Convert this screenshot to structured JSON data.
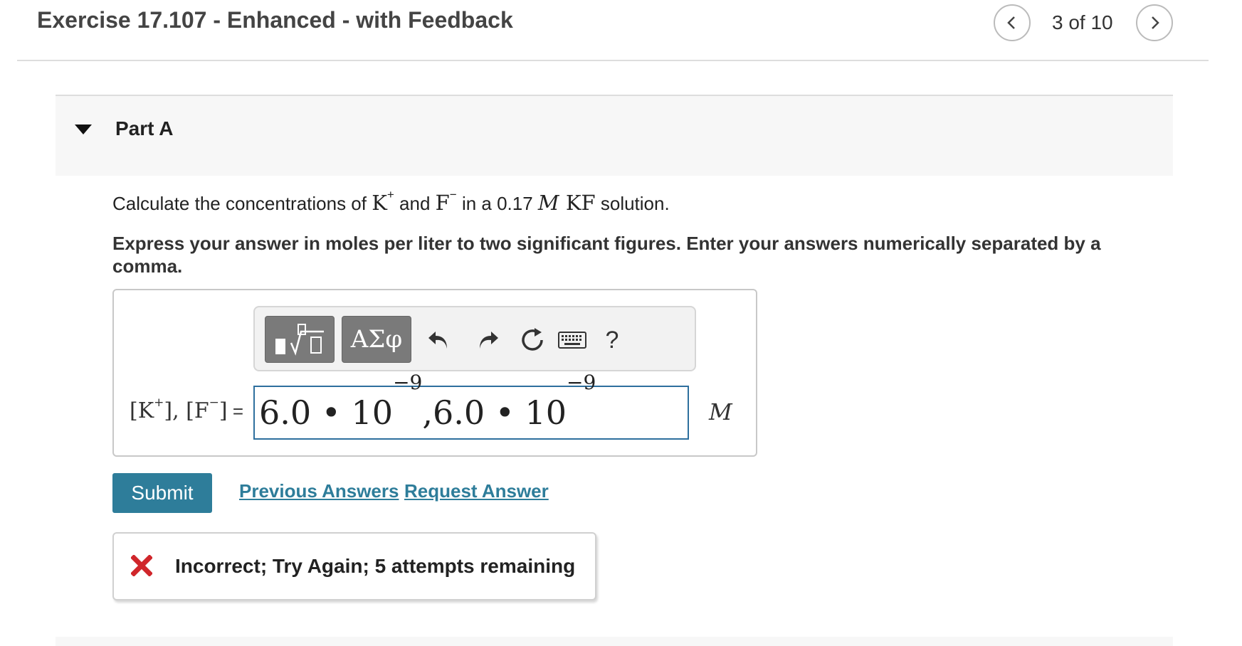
{
  "header": {
    "title": "Exercise 17.107 - Enhanced - with Feedback",
    "counter": "3 of 10"
  },
  "part": {
    "label": "Part A"
  },
  "question": {
    "prefix": "Calculate the concentrations of ",
    "ion1": "K",
    "ion1_charge": "+",
    "conj": " and ",
    "ion2": "F",
    "ion2_charge": "−",
    "mid": " in a 0.17 ",
    "unit": "M",
    "compound": " KF",
    "suffix": " solution."
  },
  "instruction": "Express your answer in moles per liter to two significant figures. Enter your answers numerically separated by a comma.",
  "toolbar": {
    "symbols_label": "ΑΣφ",
    "help_label": "?"
  },
  "answer": {
    "label_k": "[K",
    "label_k_charge": "+",
    "label_sep": "], [F",
    "label_f_charge": "−",
    "label_close": "]",
    "label_eq": " = ",
    "value_part1": "6.0 • 10",
    "exp1": "−9",
    "value_part2": ",6.0 • 10",
    "exp2": "−9",
    "unit": "M"
  },
  "actions": {
    "submit_label": "Submit",
    "previous_answers_label": "Previous Answers",
    "request_answer_label": "Request Answer"
  },
  "feedback": {
    "message": "Incorrect; Try Again; 5 attempts remaining"
  },
  "colors": {
    "accent": "#2e7d9a",
    "input_border": "#2e6f9e",
    "error": "#d0262b"
  }
}
